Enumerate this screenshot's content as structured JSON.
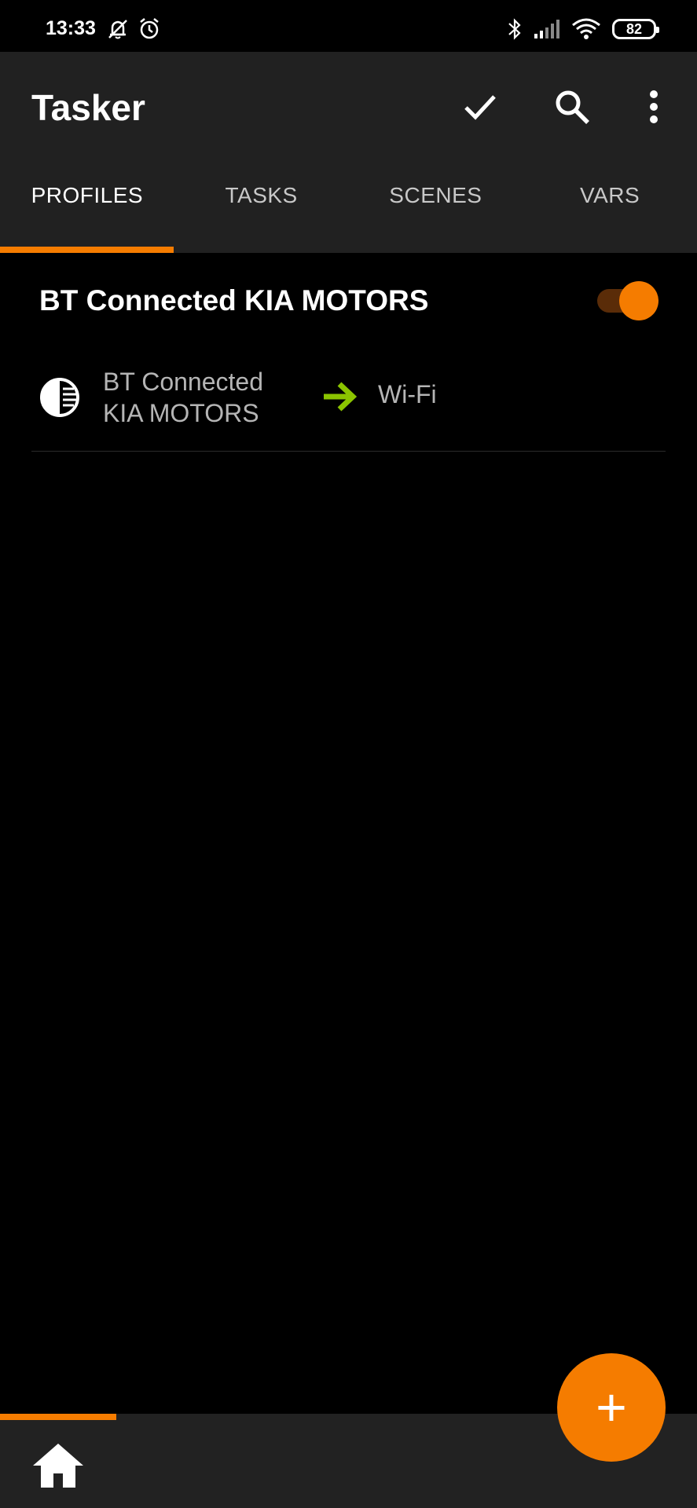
{
  "status_bar": {
    "time": "13:33",
    "battery": "82",
    "icons": [
      "muted-bell-icon",
      "alarm-clock-icon",
      "bluetooth-icon",
      "signal-icon",
      "wifi-icon",
      "battery-icon"
    ]
  },
  "appbar": {
    "title": "Tasker",
    "actions": [
      "check-icon",
      "search-icon",
      "more-vert-icon"
    ]
  },
  "tabs": [
    {
      "label": "PROFILES",
      "active": true
    },
    {
      "label": "TASKS",
      "active": false
    },
    {
      "label": "SCENES",
      "active": false
    },
    {
      "label": "VARS",
      "active": false
    }
  ],
  "profile": {
    "name": "BT Connected KIA MOTORS",
    "enabled": true,
    "context_line1": "BT Connected",
    "context_line2": "KIA MOTORS",
    "task": "Wi-Fi"
  },
  "fab": {
    "label": "+"
  },
  "colors": {
    "accent": "#f57c00",
    "appbar": "#212121",
    "background": "#000000",
    "arrow": "#8bc400"
  }
}
